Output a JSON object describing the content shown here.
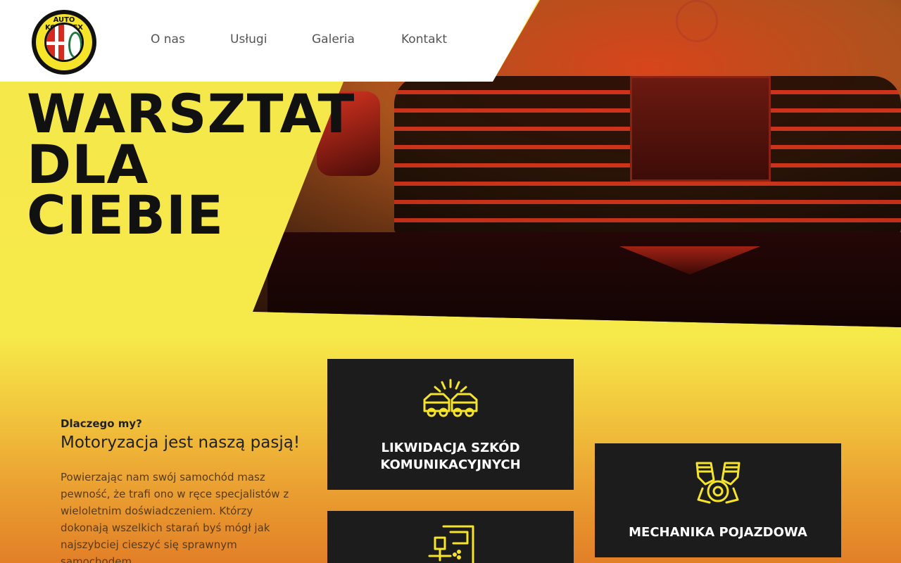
{
  "header": {
    "logo_text": "AUTO KOMPLEX",
    "nav": [
      "O nas",
      "Usługi",
      "Galeria",
      "Kontakt"
    ]
  },
  "hero": {
    "title_lines": [
      "WARSZTAT",
      "DLA",
      "CIEBIE"
    ]
  },
  "why": {
    "kicker": "Dlaczego my?",
    "title": "Motoryzacja jest naszą pasją!",
    "text": "Powierzając nam swój samochód masz pewność, że trafi ono w ręce specjalistów z wieloletnim doświadczeniem. Którzy dokonają wszelkich starań byś mógł jak najszybciej cieszyć się sprawnym samochodem."
  },
  "services": [
    {
      "label": "LIKWIDACJA SZKÓD KOMUNIKACYJNYCH",
      "icon": "car-crash-icon"
    },
    {
      "label": "MECHANIKA POJAZDOWA",
      "icon": "engine-icon"
    },
    {
      "label": "",
      "icon": "paint-spray-icon"
    }
  ],
  "colors": {
    "accent_yellow": "#f5e84a",
    "card_bg": "#1c1c1c",
    "icon_yellow": "#f5e42a"
  }
}
